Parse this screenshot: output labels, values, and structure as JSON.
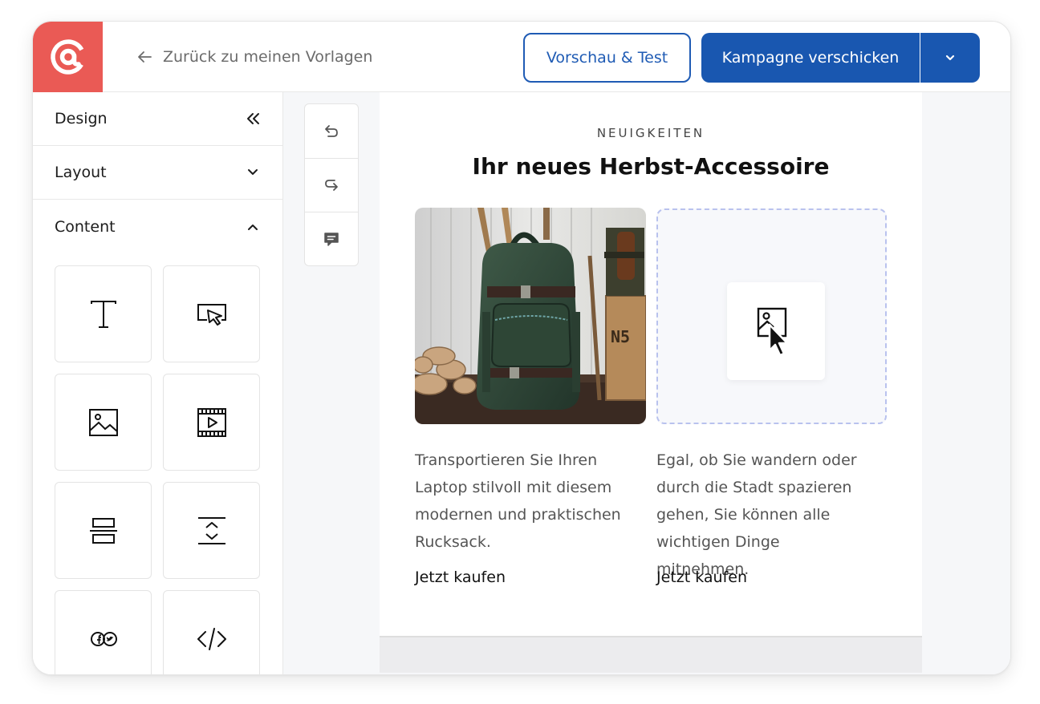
{
  "header": {
    "back_label": "Zurück zu meinen Vorlagen",
    "preview_label": "Vorschau & Test",
    "send_label": "Kampagne verschicken",
    "icons": [
      "at-sign-logo-icon",
      "arrow-left-icon",
      "chevron-down-icon"
    ]
  },
  "sidebar": {
    "sections": [
      {
        "label": "Design",
        "icon": "double-chevron-left-icon",
        "state": "collapse-panel"
      },
      {
        "label": "Layout",
        "icon": "chevron-down-icon",
        "state": "collapsed"
      },
      {
        "label": "Content",
        "icon": "chevron-up-icon",
        "state": "expanded"
      }
    ],
    "content_blocks": [
      "text-block-icon",
      "button-block-icon",
      "image-block-icon",
      "video-block-icon",
      "divider-block-icon",
      "spacer-block-icon",
      "social-block-icon",
      "html-code-block-icon"
    ]
  },
  "toolbar": {
    "tools": [
      "undo-icon",
      "redo-icon",
      "comment-icon"
    ]
  },
  "email": {
    "eyebrow": "NEUIGKEITEN",
    "headline": "Ihr neues Herbst-Accessoire",
    "columns": [
      {
        "text": "Transportieren Sie Ihren Laptop stilvoll mit diesem modernen und praktischen Rucksack.",
        "cta": "Jetzt kaufen",
        "media": "backpack-photo"
      },
      {
        "text": "Egal, ob Sie wandern oder durch die Stadt spazieren gehen, Sie können alle wichtigen Dinge mitnehmen.",
        "cta": "Jetzt kaufen",
        "media": "image-drop-zone"
      }
    ]
  },
  "colors": {
    "brand_red": "#ea5a55",
    "primary_blue": "#1957b0",
    "dropzone_border": "#b9c2ee",
    "canvas_bg": "#f6f7f9"
  }
}
